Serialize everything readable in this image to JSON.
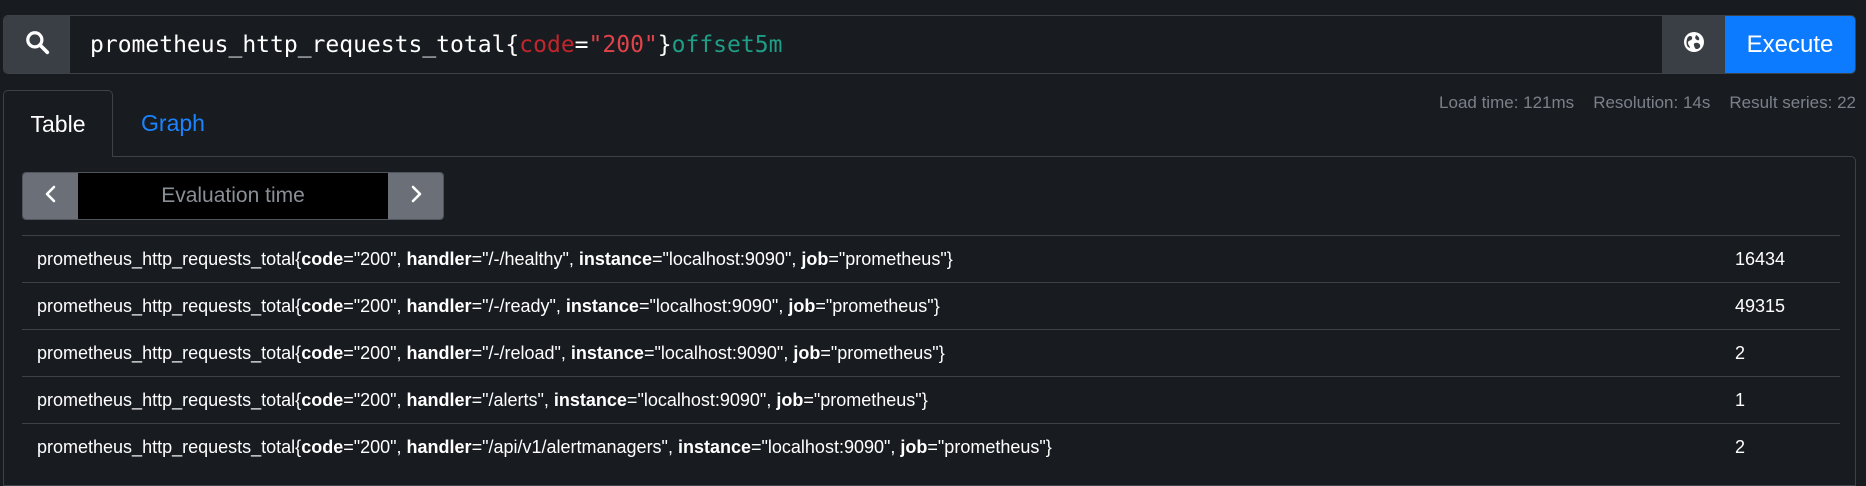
{
  "query": {
    "metric": "prometheus_http_requests_total",
    "open_brace": "{",
    "label_name": "code",
    "equals": "=",
    "label_value": "\"200\"",
    "close_brace": "}",
    "offset_keyword": "offset",
    "offset_value": "5m",
    "execute_label": "Execute"
  },
  "icons": {
    "search": "search-icon",
    "globe": "globe-icon",
    "prev": "chevron-left-icon",
    "next": "chevron-right-icon"
  },
  "tabs": [
    {
      "label": "Table",
      "active": true
    },
    {
      "label": "Graph",
      "active": false
    }
  ],
  "stats": {
    "load_time": "Load time: 121ms",
    "resolution": "Resolution: 14s",
    "result_series": "Result series: 22"
  },
  "eval": {
    "placeholder": "Evaluation time"
  },
  "rows": [
    {
      "name": "prometheus_http_requests_total",
      "labels": [
        {
          "key": "code",
          "val": "\"200\""
        },
        {
          "key": "handler",
          "val": "\"/-/healthy\""
        },
        {
          "key": "instance",
          "val": "\"localhost:9090\""
        },
        {
          "key": "job",
          "val": "\"prometheus\""
        }
      ],
      "value": "16434"
    },
    {
      "name": "prometheus_http_requests_total",
      "labels": [
        {
          "key": "code",
          "val": "\"200\""
        },
        {
          "key": "handler",
          "val": "\"/-/ready\""
        },
        {
          "key": "instance",
          "val": "\"localhost:9090\""
        },
        {
          "key": "job",
          "val": "\"prometheus\""
        }
      ],
      "value": "49315"
    },
    {
      "name": "prometheus_http_requests_total",
      "labels": [
        {
          "key": "code",
          "val": "\"200\""
        },
        {
          "key": "handler",
          "val": "\"/-/reload\""
        },
        {
          "key": "instance",
          "val": "\"localhost:9090\""
        },
        {
          "key": "job",
          "val": "\"prometheus\""
        }
      ],
      "value": "2"
    },
    {
      "name": "prometheus_http_requests_total",
      "labels": [
        {
          "key": "code",
          "val": "\"200\""
        },
        {
          "key": "handler",
          "val": "\"/alerts\""
        },
        {
          "key": "instance",
          "val": "\"localhost:9090\""
        },
        {
          "key": "job",
          "val": "\"prometheus\""
        }
      ],
      "value": "1"
    },
    {
      "name": "prometheus_http_requests_total",
      "labels": [
        {
          "key": "code",
          "val": "\"200\""
        },
        {
          "key": "handler",
          "val": "\"/api/v1/alertmanagers\""
        },
        {
          "key": "instance",
          "val": "\"localhost:9090\""
        },
        {
          "key": "job",
          "val": "\"prometheus\""
        }
      ],
      "value": "2"
    }
  ],
  "colors": {
    "background": "#181b1f",
    "accent": "#0d7bff",
    "link": "#1a84ff",
    "border": "#3d4148"
  }
}
